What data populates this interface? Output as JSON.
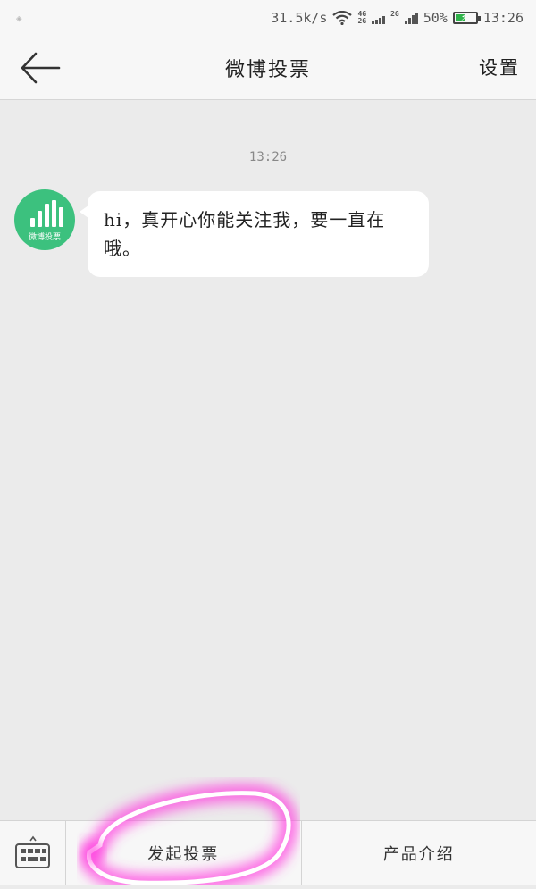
{
  "status_bar": {
    "speed": "31.5k/s",
    "net_badge_1_top": "4G",
    "net_badge_1_bottom": "2G",
    "net_badge_2_top": "2G",
    "battery_percent": "50%",
    "battery_level": 0.5,
    "time": "13:26"
  },
  "header": {
    "title": "微博投票",
    "settings_label": "设置"
  },
  "chat": {
    "timestamp": "13:26",
    "avatar_label": "微博投票",
    "message": "hi，真开心你能关注我，要一直在哦。"
  },
  "bottom_menu": {
    "items": [
      {
        "label": "发起投票"
      },
      {
        "label": "产品介绍"
      }
    ]
  },
  "colors": {
    "avatar_green": "#3cc17e",
    "highlight_pink": "#ff3ddf",
    "battery_green": "#2fb34a"
  }
}
